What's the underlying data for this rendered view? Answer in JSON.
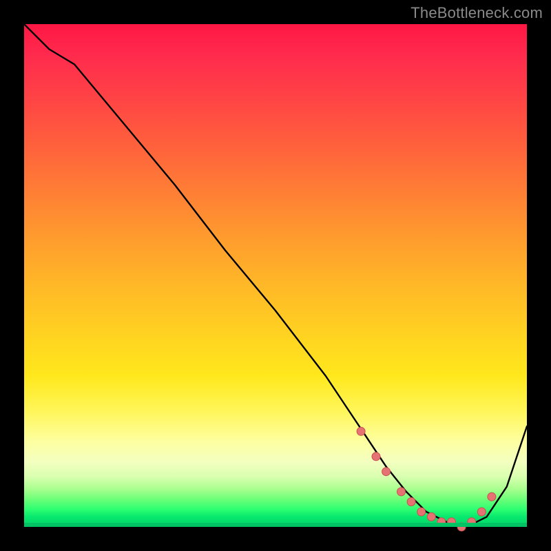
{
  "watermark": "TheBottleneck.com",
  "chart_data": {
    "type": "line",
    "title": "",
    "xlabel": "",
    "ylabel": "",
    "xlim": [
      0,
      100
    ],
    "ylim": [
      0,
      100
    ],
    "grid": false,
    "legend": false,
    "series": [
      {
        "name": "bottleneck-curve",
        "x": [
          0,
          5,
          10,
          20,
          30,
          40,
          50,
          60,
          68,
          72,
          76,
          80,
          84,
          88,
          92,
          96,
          100
        ],
        "values": [
          100,
          95,
          92,
          80,
          68,
          55,
          43,
          30,
          18,
          12,
          7,
          3,
          1,
          0,
          2,
          8,
          20
        ]
      }
    ],
    "markers": {
      "name": "highlighted-points",
      "color": "#e57373",
      "x": [
        67,
        70,
        72,
        75,
        77,
        79,
        81,
        83,
        85,
        87,
        89,
        91,
        93
      ],
      "values": [
        19,
        14,
        11,
        7,
        5,
        3,
        2,
        1,
        1,
        0,
        1,
        3,
        6
      ]
    }
  }
}
